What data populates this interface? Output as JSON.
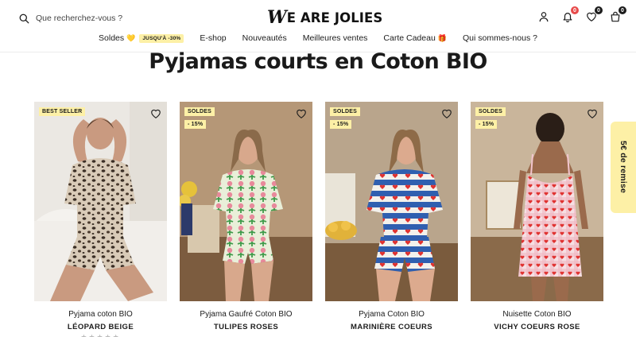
{
  "header": {
    "search_placeholder": "Que recherchez-vous ?",
    "logo_mark": "W",
    "logo_text": "E ARE JOLIES",
    "cart_badges": {
      "notifications": "0",
      "wishlist": "0",
      "cart": "0"
    }
  },
  "nav": {
    "items": [
      {
        "label": "Soldes",
        "emoji": "💛",
        "promo": "JUSQU'À -30%"
      },
      {
        "label": "E-shop"
      },
      {
        "label": "Nouveautés"
      },
      {
        "label": "Meilleures ventes"
      },
      {
        "label": "Carte Cadeau",
        "emoji": "🎁"
      },
      {
        "label": "Qui sommes-nous ?"
      }
    ]
  },
  "page": {
    "title": "Pyjamas courts en Coton BIO"
  },
  "products": [
    {
      "name": "Pyjama coton BIO",
      "variant": "LÉOPARD BEIGE",
      "tag1": "BEST SELLER",
      "tag2": "",
      "stars": "★★★★★"
    },
    {
      "name": "Pyjama Gaufré Coton BIO",
      "variant": "TULIPES ROSES",
      "tag1": "SOLDES",
      "tag2": "- 15%"
    },
    {
      "name": "Pyjama Coton BIO",
      "variant": "MARINIÈRE COEURS",
      "tag1": "SOLDES",
      "tag2": "- 15%"
    },
    {
      "name": "Nuisette Coton BIO",
      "variant": "VICHY COEURS ROSE",
      "tag1": "SOLDES",
      "tag2": "- 15%"
    }
  ],
  "side_tab": {
    "label": "5€ de remise"
  },
  "colors": {
    "accent_yellow": "#fdf0a6",
    "badge_red": "#e84b4b",
    "text": "#1c1c1c"
  }
}
